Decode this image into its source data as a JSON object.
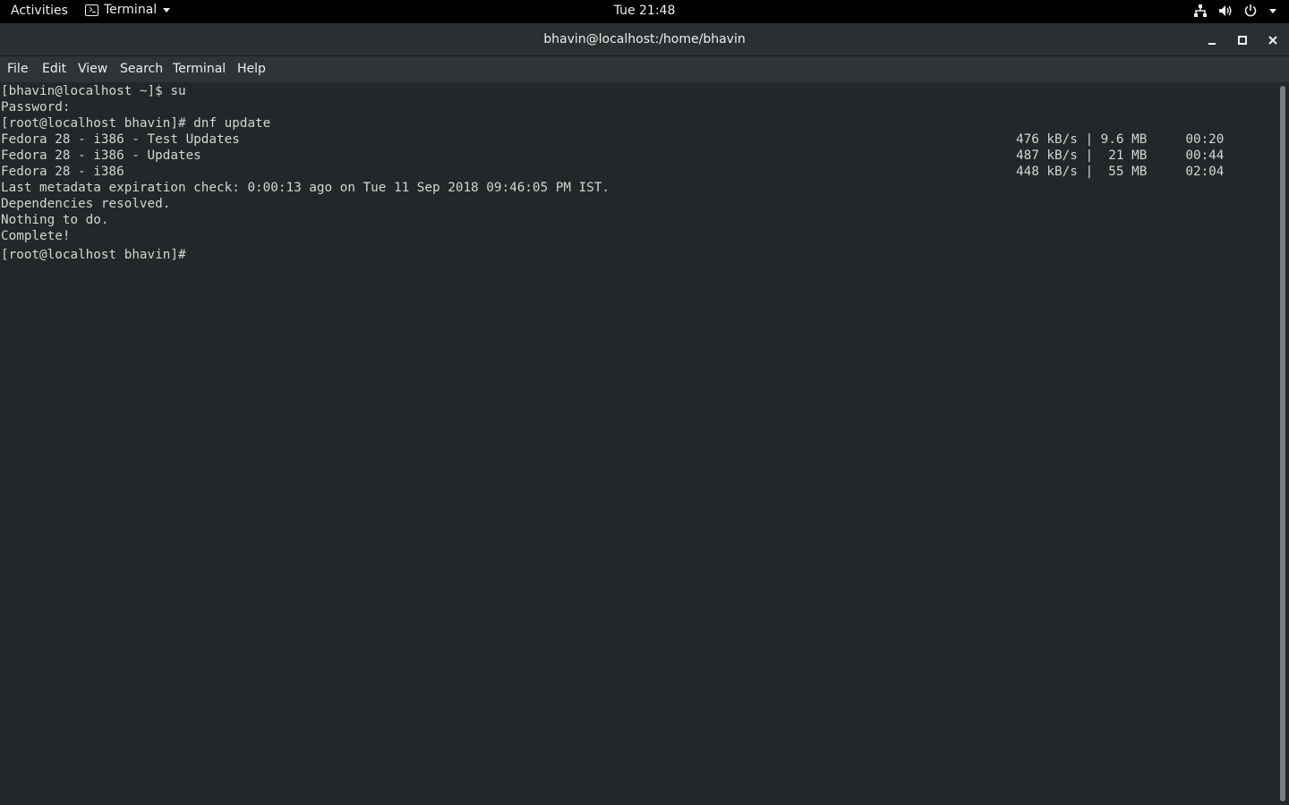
{
  "topbar": {
    "activities": "Activities",
    "app_name": "Terminal",
    "clock": "Tue 21:48"
  },
  "window": {
    "title": "bhavin@localhost:/home/bhavin"
  },
  "menubar": {
    "items": [
      "File",
      "Edit",
      "View",
      "Search",
      "Terminal",
      "Help"
    ]
  },
  "terminal": {
    "lines": [
      {
        "text": "[bhavin@localhost ~]$ su",
        "right": ""
      },
      {
        "text": "Password:",
        "right": ""
      },
      {
        "text": "[root@localhost bhavin]# dnf update",
        "right": ""
      },
      {
        "text": "Fedora 28 - i386 - Test Updates",
        "right": "476 kB/s | 9.6 MB     00:20"
      },
      {
        "text": "Fedora 28 - i386 - Updates",
        "right": "487 kB/s |  21 MB     00:44"
      },
      {
        "text": "Fedora 28 - i386",
        "right": "448 kB/s |  55 MB     02:04"
      },
      {
        "text": "Last metadata expiration check: 0:00:13 ago on Tue 11 Sep 2018 09:46:05 PM IST.",
        "right": ""
      },
      {
        "text": "Dependencies resolved.",
        "right": ""
      },
      {
        "text": "Nothing to do.",
        "right": ""
      },
      {
        "text": "Complete!",
        "right": ""
      },
      {
        "text": "[root@localhost bhavin]# ",
        "right": ""
      }
    ]
  },
  "icons": {
    "network": "network-icon",
    "volume": "volume-icon",
    "power": "power-icon"
  }
}
